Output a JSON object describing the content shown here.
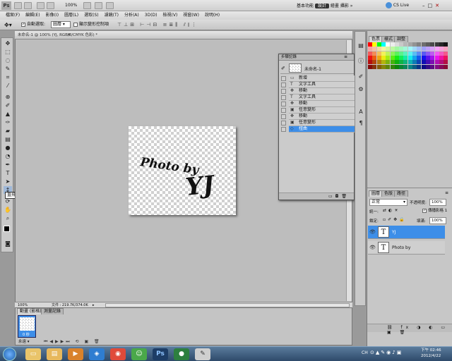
{
  "menubar": {
    "logo": "Ps",
    "zoom": "100%",
    "menus": [
      "檔案(F)",
      "編輯(E)",
      "影像(I)",
      "圖層(L)",
      "選取(S)",
      "濾鏡(T)",
      "分析(A)",
      "3D(D)",
      "檢視(V)",
      "視窗(W)",
      "說明(H)"
    ],
    "workspaces": [
      "基本功能",
      "設計",
      "繪畫",
      "攝影"
    ],
    "active_workspace": "設計",
    "cslive": "CS Live"
  },
  "options": {
    "auto_select": "自動選取:",
    "auto_select_value": "圖層",
    "show_transform": "顯示變形控制項"
  },
  "document": {
    "tab_title": "未命名-1 @ 100% (YJ, RGB/8/CMYK 色彩) *",
    "canvas_text1": "Photo by",
    "canvas_text2": "YJ",
    "status_zoom": "100%",
    "status_file": "文件 : 219.7K/374.0K"
  },
  "tooltip": "直排文字工具 (U)",
  "history": {
    "title": "步驟記錄",
    "snapshot_label": "未命名-1",
    "items": [
      {
        "label": "新增",
        "icon": "new-doc-icon",
        "symbol": "▭"
      },
      {
        "label": "文字工具",
        "icon": "type-icon",
        "symbol": "T"
      },
      {
        "label": "移動",
        "icon": "move-icon",
        "symbol": "✥"
      },
      {
        "label": "文字工具",
        "icon": "type-icon",
        "symbol": "T"
      },
      {
        "label": "移動",
        "icon": "move-icon",
        "symbol": "✥"
      },
      {
        "label": "任意變形",
        "icon": "transform-icon",
        "symbol": "▣"
      },
      {
        "label": "移動",
        "icon": "move-icon",
        "symbol": "✥"
      },
      {
        "label": "任意變形",
        "icon": "transform-icon",
        "symbol": "▣"
      },
      {
        "label": "扭曲",
        "icon": "distort-icon",
        "symbol": "◇"
      }
    ],
    "selected_index": 8
  },
  "right_panels": {
    "top_tabs": [
      "色票",
      "樣式",
      "調整"
    ],
    "layer_tabs": [
      "圖層",
      "色版",
      "路徑"
    ],
    "blend_mode": "正常",
    "opacity_label": "不透明度:",
    "opacity_value": "100%",
    "unify_label": "統一:",
    "propagate_label": "傳播影格 1",
    "lock_label": "鎖定:",
    "fill_label": "填滿:",
    "fill_value": "100%",
    "layers": [
      {
        "name": "YJ",
        "type": "text",
        "selected": true
      },
      {
        "name": "Photo by",
        "type": "text",
        "selected": false
      }
    ]
  },
  "filmstrip": {
    "tabs": [
      "動畫 (影格)",
      "測量記錄"
    ],
    "frame_time": "0 秒",
    "loop": "永遠"
  },
  "taskbar": {
    "time": "下午 02:46",
    "date": "2012/4/22",
    "lang": "CH"
  },
  "colors": {
    "accent": "#3d8ee8",
    "selected_layer": "#3d8ee8"
  }
}
